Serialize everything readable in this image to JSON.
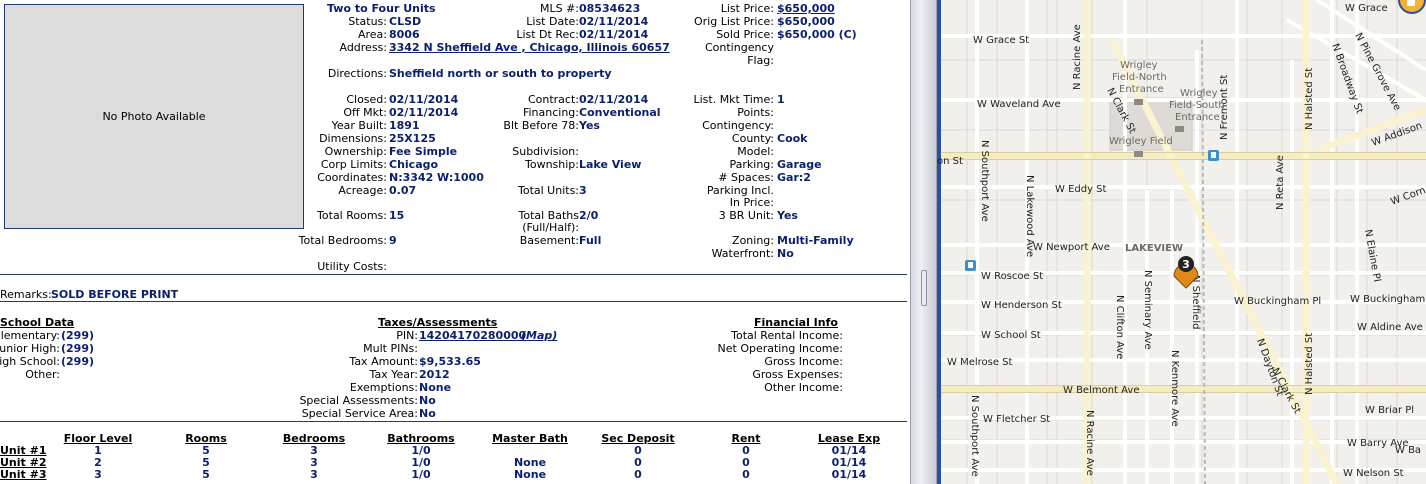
{
  "photo": {
    "text": "No Photo Available"
  },
  "header": {
    "property_type": "Two to Four Units",
    "status_label": "Status:",
    "status": "CLSD",
    "area_label": "Area:",
    "area": "8006",
    "address_label": "Address:",
    "address": "3342 N Sheffield Ave , Chicago, Illinois 60657",
    "mls_label": "MLS #:",
    "mls": "08534623",
    "list_date_label": "List Date:",
    "list_date": "02/11/2014",
    "list_dt_rec_label": "List Dt Rec:",
    "list_dt_rec": "02/11/2014",
    "list_price_label": "List Price:",
    "list_price": "$650,000",
    "orig_list_price_label": "Orig List Price:",
    "orig_list_price": "$650,000",
    "sold_price_label": "Sold Price:",
    "sold_price": "$650,000 (C)",
    "contingency_flag_label1": "Contingency",
    "contingency_flag_label2": "Flag:",
    "directions_label": "Directions:",
    "directions": "Sheffield north or south to property"
  },
  "details": {
    "closed_label": "Closed:",
    "closed": "02/11/2014",
    "off_mkt_label": "Off Mkt:",
    "off_mkt": "02/11/2014",
    "year_built_label": "Year Built:",
    "year_built": "1891",
    "dimensions_label": "Dimensions:",
    "dimensions": "25X125",
    "ownership_label": "Ownership:",
    "ownership": "Fee Simple",
    "corp_limits_label": "Corp Limits:",
    "corp_limits": "Chicago",
    "coordinates_label": "Coordinates:",
    "coordinates": "N:3342 W:1000",
    "acreage_label": "Acreage:",
    "acreage": "0.07",
    "total_rooms_label": "Total Rooms:",
    "total_rooms": "15",
    "total_bedrooms_label": "Total Bedrooms:",
    "total_bedrooms": "9",
    "utility_costs_label": "Utility Costs:",
    "contract_label": "Contract:",
    "contract": "02/11/2014",
    "financing_label": "Financing:",
    "financing": "Conventional",
    "blt_before_label": "Blt Before 78:",
    "blt_before": "Yes",
    "subdivision_label": "Subdivision:",
    "township_label": "Township:",
    "township": "Lake View",
    "total_units_label": "Total Units:",
    "total_units": "3",
    "total_baths_label1": "Total Baths",
    "total_baths_label2": "(Full/Half):",
    "total_baths": "2/0",
    "basement_label": "Basement:",
    "basement": "Full",
    "list_mkt_time_label": "List. Mkt Time:",
    "list_mkt_time": "1",
    "points_label": "Points:",
    "contingency_label": "Contingency:",
    "county_label": "County:",
    "county": "Cook",
    "model_label": "Model:",
    "parking_label": "Parking:",
    "parking": "Garage",
    "spaces_label": "# Spaces:",
    "spaces": "Gar:2",
    "parking_incl_label1": "Parking Incl.",
    "parking_incl_label2": "In Price:",
    "br3_unit_label": "3 BR Unit:",
    "br3_unit": "Yes",
    "zoning_label": "Zoning:",
    "zoning": "Multi-Family",
    "waterfront_label": "Waterfront:",
    "waterfront": "No"
  },
  "remarks": {
    "label": "Remarks:",
    "text": "SOLD BEFORE PRINT"
  },
  "school": {
    "title": "School Data",
    "elementary_label": "Elementary:",
    "elementary": "(299)",
    "junior_label": "Junior High:",
    "junior": "(299)",
    "high_label": "High School:",
    "high": "(299)",
    "other_label": "Other:"
  },
  "taxes": {
    "title": "Taxes/Assessments",
    "pin_label": "PIN:",
    "pin": "14204170280000",
    "map_link": "(Map)",
    "mult_pins_label": "Mult PINs:",
    "tax_amount_label": "Tax Amount:",
    "tax_amount": "$9,533.65",
    "tax_year_label": "Tax Year:",
    "tax_year": "2012",
    "exemptions_label": "Exemptions:",
    "exemptions": "None",
    "special_assess_label": "Special Assessments:",
    "special_assess": "No",
    "special_service_label": "Special Service Area:",
    "special_service": "No"
  },
  "financial": {
    "title": "Financial Info",
    "total_rental_label": "Total Rental Income:",
    "net_operating_label": "Net Operating Income:",
    "gross_income_label": "Gross Income:",
    "gross_expenses_label": "Gross Expenses:",
    "other_income_label": "Other Income:"
  },
  "units_table": {
    "headers": [
      "Floor Level",
      "Rooms",
      "Bedrooms",
      "Bathrooms",
      "Master Bath",
      "Sec Deposit",
      "Rent",
      "Lease Exp"
    ],
    "rows": [
      {
        "unit": "Unit #1",
        "cells": [
          "1",
          "5",
          "3",
          "1/0",
          "",
          "0",
          "0",
          "01/14"
        ]
      },
      {
        "unit": "Unit #2",
        "cells": [
          "2",
          "5",
          "3",
          "1/0",
          "None",
          "0",
          "0",
          "01/14"
        ]
      },
      {
        "unit": "Unit #3",
        "cells": [
          "3",
          "5",
          "3",
          "1/0",
          "None",
          "0",
          "0",
          "01/14"
        ]
      }
    ]
  },
  "map": {
    "streets": {
      "w_grace": "W Grace St",
      "w_grace_top": "W Grace",
      "w_waveland": "W Waveland Ave",
      "on_st": "on St",
      "w_addison": "W Addison",
      "w_eddy": "W Eddy St",
      "w_newport": "W Newport Ave",
      "w_roscoe": "W Roscoe St",
      "w_henderson": "W Henderson St",
      "w_school": "W School St",
      "w_melrose": "W Melrose St",
      "w_belmont": "W Belmont Ave",
      "w_fletcher": "W Fletcher St",
      "w_barry": "W Barry Ave",
      "w_nelson": "W Nelson St",
      "w_buckingham": "W Buckingham Pl",
      "w_buckingham2": "W Buckingham Pl",
      "w_aldine": "W Aldine Ave",
      "w_briar": "W Briar Pl",
      "w_barry2": "W Barry Ave",
      "n_southport": "N Southport Ave",
      "n_southport2": "N Southport Ave",
      "n_lakewood": "N Lakewood Ave",
      "n_racine": "N Racine Ave",
      "n_racine2": "N Racine Ave",
      "n_clark": "N Clark St",
      "n_clark2": "N Clark St",
      "n_clifton": "N Clifton Ave",
      "n_seminary": "N Seminary Ave",
      "n_kenmore": "N Kenmore Ave",
      "n_sheffield": "N Sheffield",
      "n_fremont": "N Fremont St",
      "n_halsted": "N Halsted St",
      "n_halsted2": "N Halsted St",
      "n_reta": "N Reta Ave",
      "n_pine_grove": "N Pine Grove Ave",
      "n_broadway": "N Broadway St",
      "n_dayton": "N Dayton St",
      "n_elaine": "N Elaine Pl",
      "w_corn": "W Corn",
      "w_ba": "W Ba"
    },
    "places": {
      "wrigley_north1": "Wrigley",
      "wrigley_north2": "Field-North",
      "wrigley_north3": "Entrance",
      "wrigley_south1": "Wrigley",
      "wrigley_south2": "Field-South",
      "wrigley_south3": "Entrance",
      "wrigley_field": "Wrigley Field",
      "lakeview": "LAKEVIEW"
    },
    "marker": {
      "label": "3",
      "color": "#e0891a"
    }
  }
}
